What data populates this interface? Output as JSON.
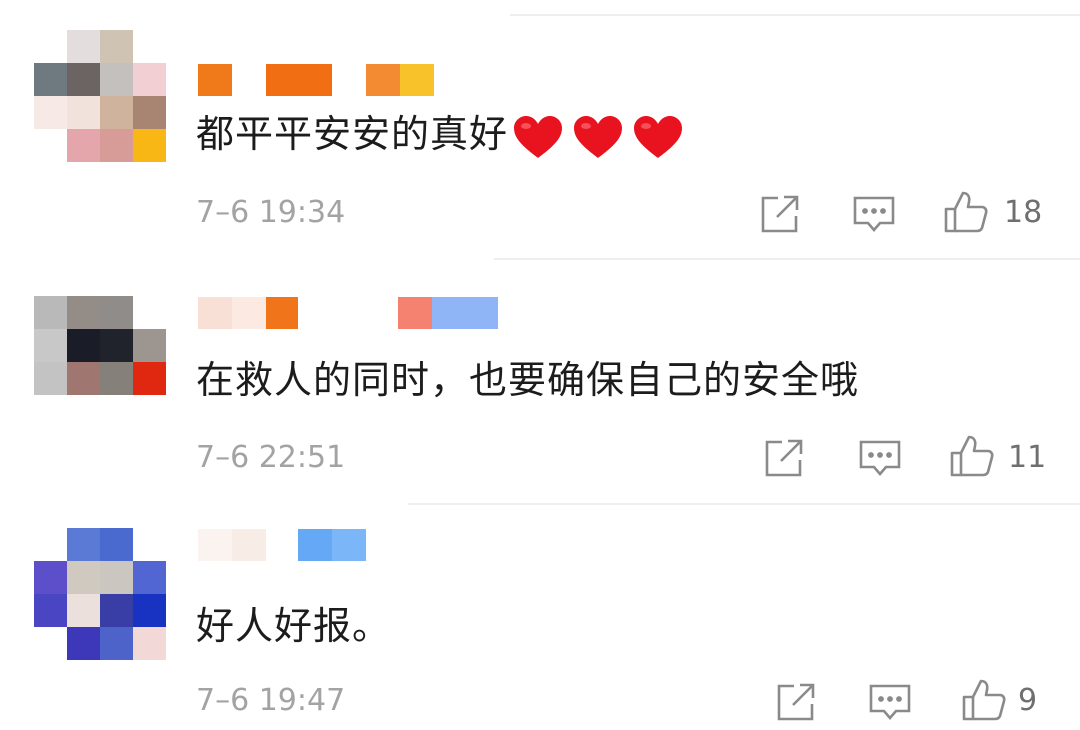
{
  "comments": [
    {
      "text": "都平平安安的真好",
      "hearts": [
        "heart-emoji",
        "heart-emoji",
        "heart-emoji"
      ],
      "time": "7–6 19:34",
      "likes": "18"
    },
    {
      "text": "在救人的同时，也要确保自己的安全哦",
      "time": "7–6 22:51",
      "likes": "11"
    },
    {
      "text": "好人好报。",
      "time": "7–6 19:47",
      "likes": "9"
    }
  ],
  "colors": {
    "text": "#1c1c1c",
    "meta": "#a3a3a3",
    "icon": "#8a8a8a",
    "heart": "#e8131f"
  },
  "icons": [
    "share-icon",
    "reply-icon",
    "like-icon"
  ]
}
